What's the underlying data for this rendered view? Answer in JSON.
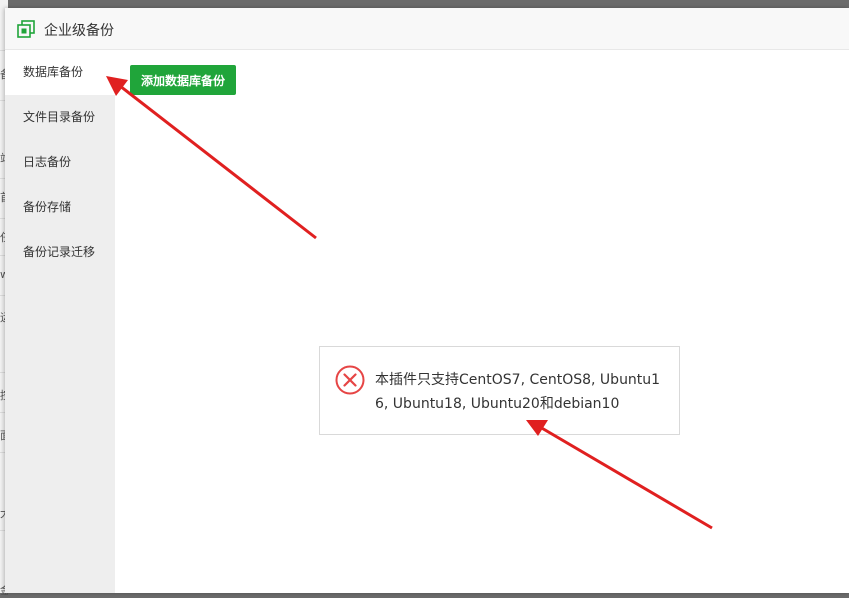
{
  "window": {
    "title": "企业级备份"
  },
  "sidebar": {
    "items": [
      {
        "label": "数据库备份",
        "active": true
      },
      {
        "label": "文件目录备份",
        "active": false
      },
      {
        "label": "日志备份",
        "active": false
      },
      {
        "label": "备份存储",
        "active": false
      },
      {
        "label": "备份记录迁移",
        "active": false
      }
    ]
  },
  "toolbar": {
    "add_label": "添加数据库备份"
  },
  "message": {
    "text": "本插件只支持CentOS7, CentOS8, Ubuntu16, Ubuntu18, Ubuntu20和debian10",
    "icon": "error-circle-icon"
  },
  "background_fragments": [
    "备",
    "站",
    "首",
    "任",
    "w",
    "运",
    "控",
    "面",
    "大",
    "金"
  ],
  "colors": {
    "accent": "#20a53a",
    "error": "#e64545",
    "annotation": "#e02020",
    "sidebar_bg": "#eeeeee"
  }
}
